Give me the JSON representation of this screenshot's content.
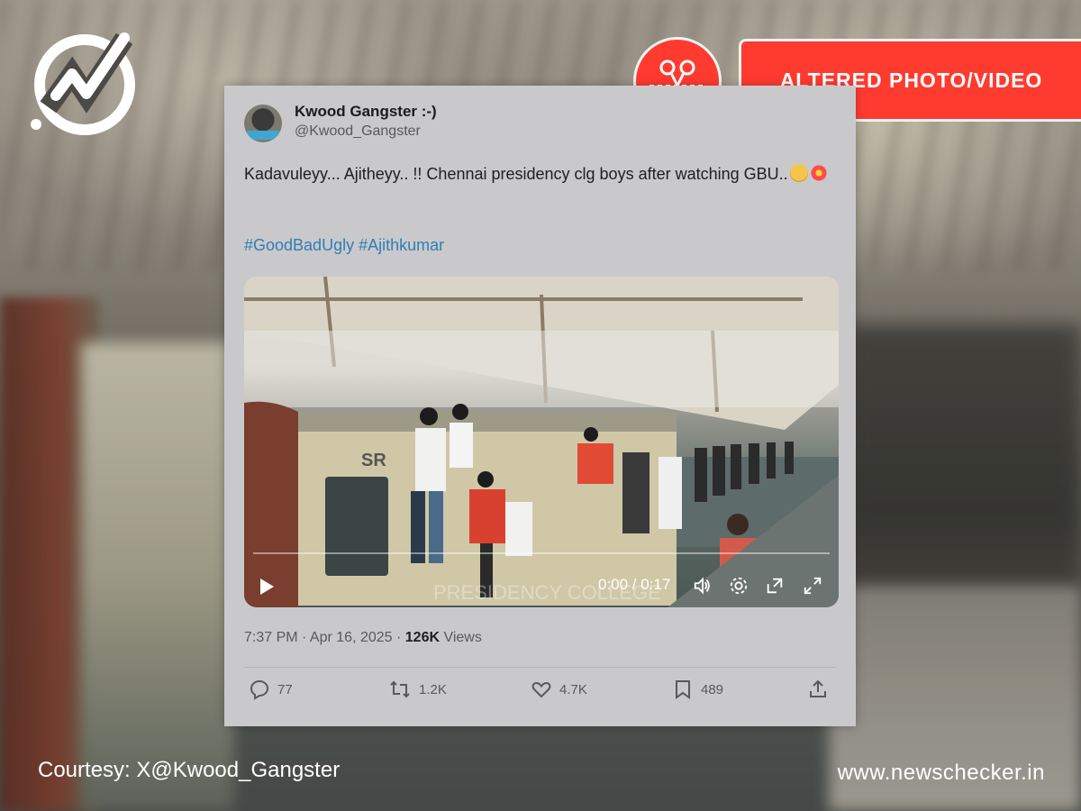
{
  "rating": {
    "label": "ALTERED PHOTO/VIDEO",
    "color": "#ff3b30",
    "icon": "scissors-icon"
  },
  "tweet": {
    "display_name": "Kwood Gangster :-)",
    "handle": "@Kwood_Gangster",
    "text": "Kadavuleyy...  Ajitheyy.. !! Chennai presidency clg boys after watching GBU..",
    "hashtags": "#GoodBadUgly #Ajithkumar",
    "video": {
      "time": "0:00 / 0:17",
      "watermark": "PRESIDENCY COLLEGE",
      "train_label": "SR"
    },
    "meta": {
      "time": "7:37 PM · Apr 16, 2025 · ",
      "views_count": "126K",
      "views_label": " Views"
    },
    "actions": {
      "replies": "77",
      "reposts": "1.2K",
      "likes": "4.7K",
      "bookmarks": "489"
    }
  },
  "footer": {
    "courtesy": "Courtesy: X@Kwood_Gangster",
    "site": "www.newschecker.in"
  },
  "colors": {
    "link": "#2f7fb5",
    "badge_red": "#ff3b30"
  }
}
